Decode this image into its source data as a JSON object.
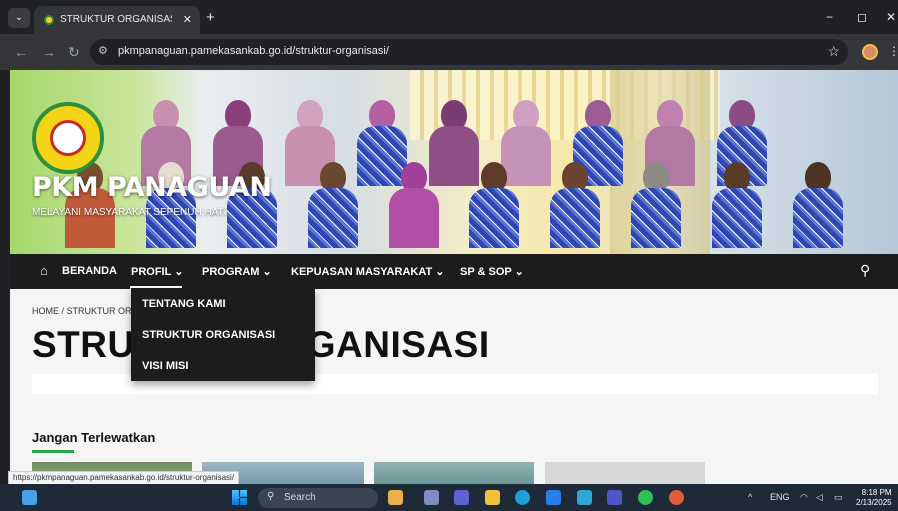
{
  "browser": {
    "tab_title": "STRUKTUR ORGANISASI – PKM",
    "tab_close": "✕",
    "new_tab": "+",
    "url": "pkmpanaguan.pamekasankab.go.id/struktur-organisasi/",
    "status_url": "https://pkmpanaguan.pamekasankab.go.id/struktur-organisasi/"
  },
  "site": {
    "title": "PKM PANAGUAN",
    "tagline": "MELAYANI MASYARAKAT SEPENUH HATI"
  },
  "nav": {
    "items": [
      {
        "label": "BERANDA"
      },
      {
        "label": "PROFIL ⌄"
      },
      {
        "label": "PROGRAM ⌄"
      },
      {
        "label": "KEPUASAN MASYARAKAT ⌄"
      },
      {
        "label": "SP & SOP ⌄"
      }
    ],
    "dropdown": [
      {
        "label": "TENTANG KAMI"
      },
      {
        "label": "STRUKTUR ORGANISASI"
      },
      {
        "label": "VISI MISI"
      }
    ]
  },
  "content": {
    "breadcrumb": "HOME / STRUKTUR OR",
    "page_title": "STRUKTUR ORGANISASI",
    "section_title": "Jangan Terlewatkan"
  },
  "taskbar": {
    "search_label": "Search",
    "lang": "ENG",
    "time": "8:18 PM",
    "date": "2/13/2025"
  },
  "icons": {
    "home": "home-icon",
    "search": "search-icon",
    "star": "star-icon"
  }
}
